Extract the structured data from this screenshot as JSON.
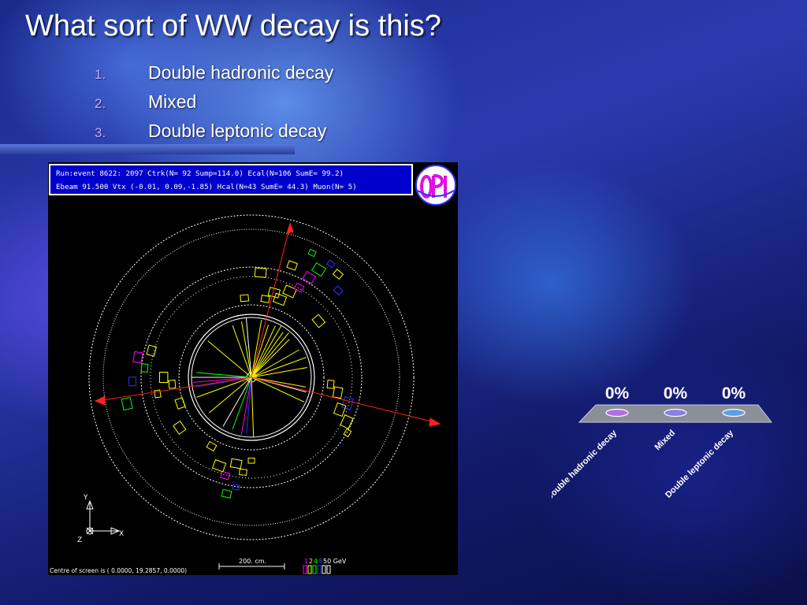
{
  "slide": {
    "title": "What sort of WW decay is this?",
    "options": [
      {
        "number": "1.",
        "label": "Double hadronic decay"
      },
      {
        "number": "2.",
        "label": "Mixed"
      },
      {
        "number": "3.",
        "label": "Double leptonic decay"
      }
    ]
  },
  "event_display": {
    "header_line1": "Run:event 8622:  2097    Ctrk(N= 92 Sump=114.0) Ecal(N=106 SumE= 99.2)",
    "header_line2": "Ebeam 91.500 Vtx (-0.01, 0.09,-1.85)  Hcal(N=43 SumE= 44.3) Muon(N= 5)",
    "axis_y": "Y",
    "axis_z": "Z",
    "axis_x": "X",
    "scale_label": "200. cm.",
    "energy_scale": {
      "n1": "1",
      "n2": "2",
      "n3": "4",
      "n4": "8",
      "n5": "50 GeV"
    },
    "footer": "Centre of screen is (   0.0000,  19.2857,   0.0000)",
    "colors": {
      "tracks": "#ffff00",
      "frame": "#ffffff",
      "ecal": "#ff00ff",
      "hcal": "#00ff00",
      "muon": "#ff2020",
      "header_text": "#ffffff",
      "header_bg": "#0000cc",
      "header_border": "#ffffff",
      "logo": "#e010e0"
    }
  },
  "chart_data": {
    "type": "bar",
    "categories": [
      "Double hadronic decay",
      "Mixed",
      "Double leptonic decay"
    ],
    "values": [
      0,
      0,
      0
    ],
    "value_labels": [
      "0%",
      "0%",
      "0%"
    ],
    "colors": [
      "#b070e0",
      "#8a80e0",
      "#60a0e0"
    ]
  }
}
